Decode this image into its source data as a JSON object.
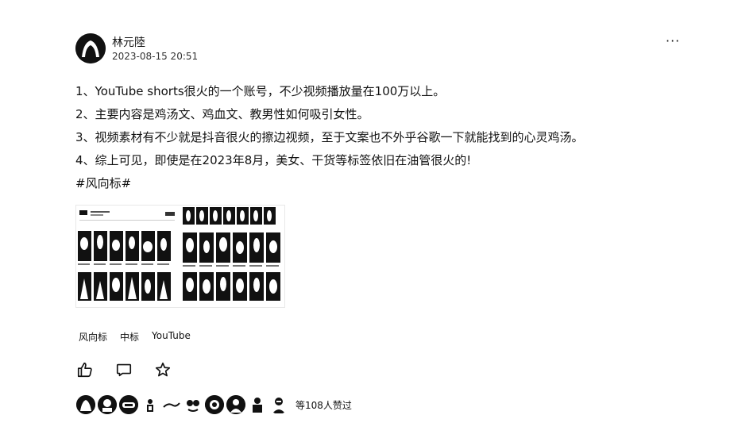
{
  "post": {
    "author": "林元陸",
    "timestamp": "2023-08-15 20:51",
    "more_label": "···",
    "lines": [
      "1、YouTube shorts很火的一个账号，不少视频播放量在100万以上。",
      "2、主要内容是鸡汤文、鸡血文、教男性如何吸引女性。",
      "3、视频素材有不少就是抖音很火的擦边视频，至于文案也不外乎谷歌一下就能找到的心灵鸡汤。",
      "4、综上可见，即使是在2023年8月，美女、干货等标签依旧在油管很火的!"
    ],
    "hashtag": "#风向标#",
    "tags": [
      "风向标",
      "中标",
      "YouTube"
    ],
    "like_summary": "等108人赞过"
  },
  "icons": {
    "like": "thumbs-up-icon",
    "comment": "comment-icon",
    "favorite": "star-icon",
    "more": "more-dots-icon"
  },
  "colors": {
    "text": "#111111",
    "background": "#ffffff"
  }
}
